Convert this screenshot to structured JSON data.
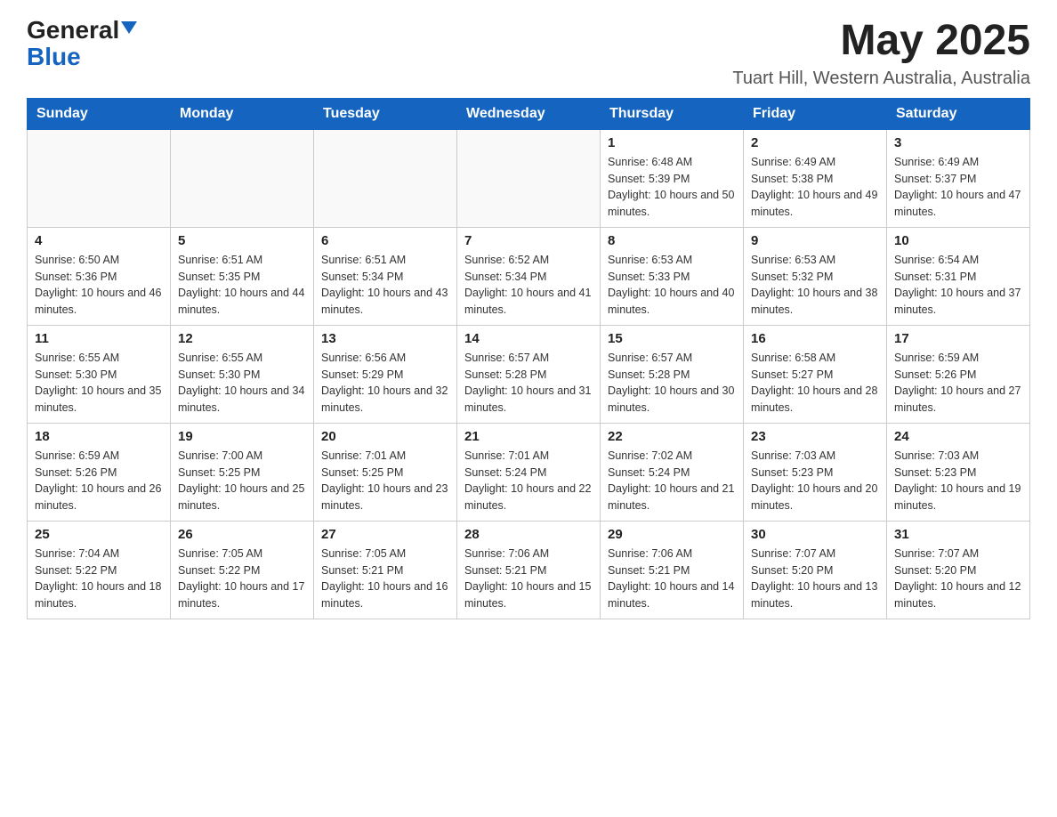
{
  "logo": {
    "general": "General",
    "blue": "Blue"
  },
  "header": {
    "month_year": "May 2025",
    "location": "Tuart Hill, Western Australia, Australia"
  },
  "days_of_week": [
    "Sunday",
    "Monday",
    "Tuesday",
    "Wednesday",
    "Thursday",
    "Friday",
    "Saturday"
  ],
  "weeks": [
    [
      {
        "day": "",
        "info": ""
      },
      {
        "day": "",
        "info": ""
      },
      {
        "day": "",
        "info": ""
      },
      {
        "day": "",
        "info": ""
      },
      {
        "day": "1",
        "info": "Sunrise: 6:48 AM\nSunset: 5:39 PM\nDaylight: 10 hours and 50 minutes."
      },
      {
        "day": "2",
        "info": "Sunrise: 6:49 AM\nSunset: 5:38 PM\nDaylight: 10 hours and 49 minutes."
      },
      {
        "day": "3",
        "info": "Sunrise: 6:49 AM\nSunset: 5:37 PM\nDaylight: 10 hours and 47 minutes."
      }
    ],
    [
      {
        "day": "4",
        "info": "Sunrise: 6:50 AM\nSunset: 5:36 PM\nDaylight: 10 hours and 46 minutes."
      },
      {
        "day": "5",
        "info": "Sunrise: 6:51 AM\nSunset: 5:35 PM\nDaylight: 10 hours and 44 minutes."
      },
      {
        "day": "6",
        "info": "Sunrise: 6:51 AM\nSunset: 5:34 PM\nDaylight: 10 hours and 43 minutes."
      },
      {
        "day": "7",
        "info": "Sunrise: 6:52 AM\nSunset: 5:34 PM\nDaylight: 10 hours and 41 minutes."
      },
      {
        "day": "8",
        "info": "Sunrise: 6:53 AM\nSunset: 5:33 PM\nDaylight: 10 hours and 40 minutes."
      },
      {
        "day": "9",
        "info": "Sunrise: 6:53 AM\nSunset: 5:32 PM\nDaylight: 10 hours and 38 minutes."
      },
      {
        "day": "10",
        "info": "Sunrise: 6:54 AM\nSunset: 5:31 PM\nDaylight: 10 hours and 37 minutes."
      }
    ],
    [
      {
        "day": "11",
        "info": "Sunrise: 6:55 AM\nSunset: 5:30 PM\nDaylight: 10 hours and 35 minutes."
      },
      {
        "day": "12",
        "info": "Sunrise: 6:55 AM\nSunset: 5:30 PM\nDaylight: 10 hours and 34 minutes."
      },
      {
        "day": "13",
        "info": "Sunrise: 6:56 AM\nSunset: 5:29 PM\nDaylight: 10 hours and 32 minutes."
      },
      {
        "day": "14",
        "info": "Sunrise: 6:57 AM\nSunset: 5:28 PM\nDaylight: 10 hours and 31 minutes."
      },
      {
        "day": "15",
        "info": "Sunrise: 6:57 AM\nSunset: 5:28 PM\nDaylight: 10 hours and 30 minutes."
      },
      {
        "day": "16",
        "info": "Sunrise: 6:58 AM\nSunset: 5:27 PM\nDaylight: 10 hours and 28 minutes."
      },
      {
        "day": "17",
        "info": "Sunrise: 6:59 AM\nSunset: 5:26 PM\nDaylight: 10 hours and 27 minutes."
      }
    ],
    [
      {
        "day": "18",
        "info": "Sunrise: 6:59 AM\nSunset: 5:26 PM\nDaylight: 10 hours and 26 minutes."
      },
      {
        "day": "19",
        "info": "Sunrise: 7:00 AM\nSunset: 5:25 PM\nDaylight: 10 hours and 25 minutes."
      },
      {
        "day": "20",
        "info": "Sunrise: 7:01 AM\nSunset: 5:25 PM\nDaylight: 10 hours and 23 minutes."
      },
      {
        "day": "21",
        "info": "Sunrise: 7:01 AM\nSunset: 5:24 PM\nDaylight: 10 hours and 22 minutes."
      },
      {
        "day": "22",
        "info": "Sunrise: 7:02 AM\nSunset: 5:24 PM\nDaylight: 10 hours and 21 minutes."
      },
      {
        "day": "23",
        "info": "Sunrise: 7:03 AM\nSunset: 5:23 PM\nDaylight: 10 hours and 20 minutes."
      },
      {
        "day": "24",
        "info": "Sunrise: 7:03 AM\nSunset: 5:23 PM\nDaylight: 10 hours and 19 minutes."
      }
    ],
    [
      {
        "day": "25",
        "info": "Sunrise: 7:04 AM\nSunset: 5:22 PM\nDaylight: 10 hours and 18 minutes."
      },
      {
        "day": "26",
        "info": "Sunrise: 7:05 AM\nSunset: 5:22 PM\nDaylight: 10 hours and 17 minutes."
      },
      {
        "day": "27",
        "info": "Sunrise: 7:05 AM\nSunset: 5:21 PM\nDaylight: 10 hours and 16 minutes."
      },
      {
        "day": "28",
        "info": "Sunrise: 7:06 AM\nSunset: 5:21 PM\nDaylight: 10 hours and 15 minutes."
      },
      {
        "day": "29",
        "info": "Sunrise: 7:06 AM\nSunset: 5:21 PM\nDaylight: 10 hours and 14 minutes."
      },
      {
        "day": "30",
        "info": "Sunrise: 7:07 AM\nSunset: 5:20 PM\nDaylight: 10 hours and 13 minutes."
      },
      {
        "day": "31",
        "info": "Sunrise: 7:07 AM\nSunset: 5:20 PM\nDaylight: 10 hours and 12 minutes."
      }
    ]
  ]
}
